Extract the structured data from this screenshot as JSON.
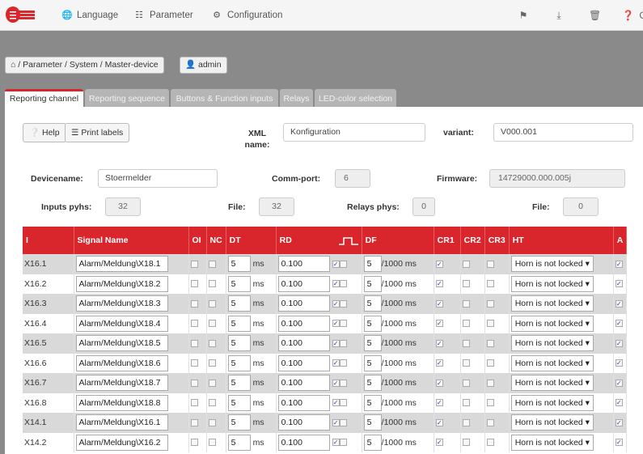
{
  "nav": {
    "language": "Language",
    "parameter": "Parameter",
    "configuration": "Configuration"
  },
  "toolbar_icons": [
    "flag-icon",
    "download-icon",
    "trash-icon",
    "help-icon"
  ],
  "breadcrumb": "/ Parameter / System / Master-device",
  "user": "admin",
  "tabs": [
    {
      "label": "Reporting channel",
      "active": true
    },
    {
      "label": "Reporting sequence",
      "active": false
    },
    {
      "label": "Buttons & Function inputs",
      "active": false
    },
    {
      "label": "Relays",
      "active": false
    },
    {
      "label": "LED-color selection",
      "active": false
    }
  ],
  "buttons": {
    "help": "Help",
    "print_labels": "Print labels"
  },
  "form": {
    "xml_label": "XML name:",
    "xml_value": "Konfiguration",
    "variant_label": "variant:",
    "variant_value": "V000.001",
    "devicename_label": "Devicename:",
    "devicename_value": "Stoermelder",
    "commport_label": "Comm-port:",
    "commport_value": "6",
    "firmware_label": "Firmware:",
    "firmware_value": "14729000.000.005j",
    "inputs_label": "Inputs pyhs:",
    "inputs_value": "32",
    "file1_label": "File:",
    "file1_value": "32",
    "relays_label": "Relays phys:",
    "relays_value": "0",
    "file2_label": "File:",
    "file2_value": "0"
  },
  "table": {
    "headers": [
      "I",
      "Signal Name",
      "OI",
      "NC",
      "DT",
      "RD",
      "DF",
      "CR1",
      "CR2",
      "CR3",
      "HT",
      "A"
    ],
    "units": {
      "ms": "ms",
      "per1000": "/1000",
      "ms2": "ms"
    },
    "rows": [
      {
        "id": "X16.1",
        "name": "Alarm/Meldung\\X18.1",
        "dt": "5",
        "rd": "0.100",
        "df": "5",
        "ht": "Horn is not locked"
      },
      {
        "id": "X16.2",
        "name": "Alarm/Meldung\\X18.2",
        "dt": "5",
        "rd": "0.100",
        "df": "5",
        "ht": "Horn is not locked"
      },
      {
        "id": "X16.3",
        "name": "Alarm/Meldung\\X18.3",
        "dt": "5",
        "rd": "0.100",
        "df": "5",
        "ht": "Horn is not locked"
      },
      {
        "id": "X16.4",
        "name": "Alarm/Meldung\\X18.4",
        "dt": "5",
        "rd": "0.100",
        "df": "5",
        "ht": "Horn is not locked"
      },
      {
        "id": "X16.5",
        "name": "Alarm/Meldung\\X18.5",
        "dt": "5",
        "rd": "0.100",
        "df": "5",
        "ht": "Horn is not locked"
      },
      {
        "id": "X16.6",
        "name": "Alarm/Meldung\\X18.6",
        "dt": "5",
        "rd": "0.100",
        "df": "5",
        "ht": "Horn is not locked"
      },
      {
        "id": "X16.7",
        "name": "Alarm/Meldung\\X18.7",
        "dt": "5",
        "rd": "0.100",
        "df": "5",
        "ht": "Horn is not locked"
      },
      {
        "id": "X16.8",
        "name": "Alarm/Meldung\\X18.8",
        "dt": "5",
        "rd": "0.100",
        "df": "5",
        "ht": "Horn is not locked"
      },
      {
        "id": "X14.1",
        "name": "Alarm/Meldung\\X16.1",
        "dt": "5",
        "rd": "0.100",
        "df": "5",
        "ht": "Horn is not locked"
      },
      {
        "id": "X14.2",
        "name": "Alarm/Meldung\\X16.2",
        "dt": "5",
        "rd": "0.100",
        "df": "5",
        "ht": "Horn is not locked"
      }
    ]
  },
  "colors": {
    "accent": "#d9262c",
    "dark_bar": "#8a8a8a",
    "row_shade": "#d9d9d9"
  }
}
